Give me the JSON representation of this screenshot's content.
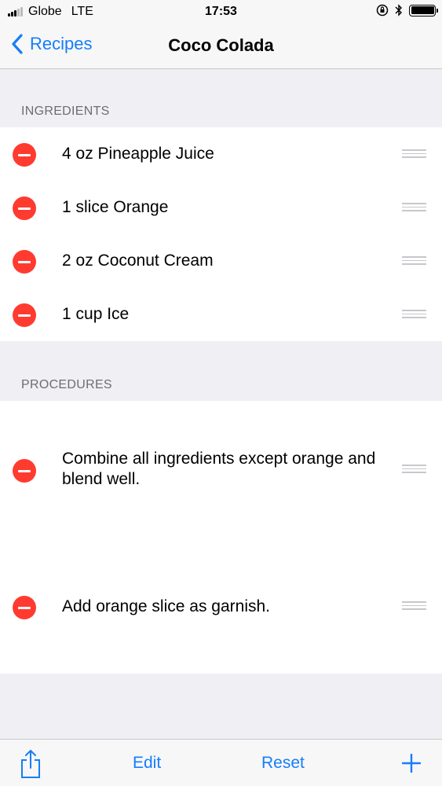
{
  "status_bar": {
    "carrier": "Globe",
    "network": "LTE",
    "time": "17:53"
  },
  "nav": {
    "back_label": "Recipes",
    "title": "Coco Colada"
  },
  "ingredients": {
    "header": "INGREDIENTS",
    "items": [
      {
        "label": "4 oz Pineapple Juice"
      },
      {
        "label": "1 slice Orange"
      },
      {
        "label": "2 oz Coconut Cream"
      },
      {
        "label": "1 cup Ice"
      }
    ]
  },
  "procedures": {
    "header": "PROCEDURES",
    "items": [
      {
        "label": "Combine all ingredients except orange and blend well."
      },
      {
        "label": "Add orange slice as garnish."
      }
    ]
  },
  "toolbar": {
    "edit_label": "Edit",
    "reset_label": "Reset"
  },
  "icons": {
    "share": "share-icon",
    "add": "plus-icon",
    "delete": "minus-circle-icon",
    "reorder": "reorder-grip-icon"
  },
  "colors": {
    "accent": "#157efb",
    "delete": "#ff3b30",
    "background": "#efeff4"
  }
}
